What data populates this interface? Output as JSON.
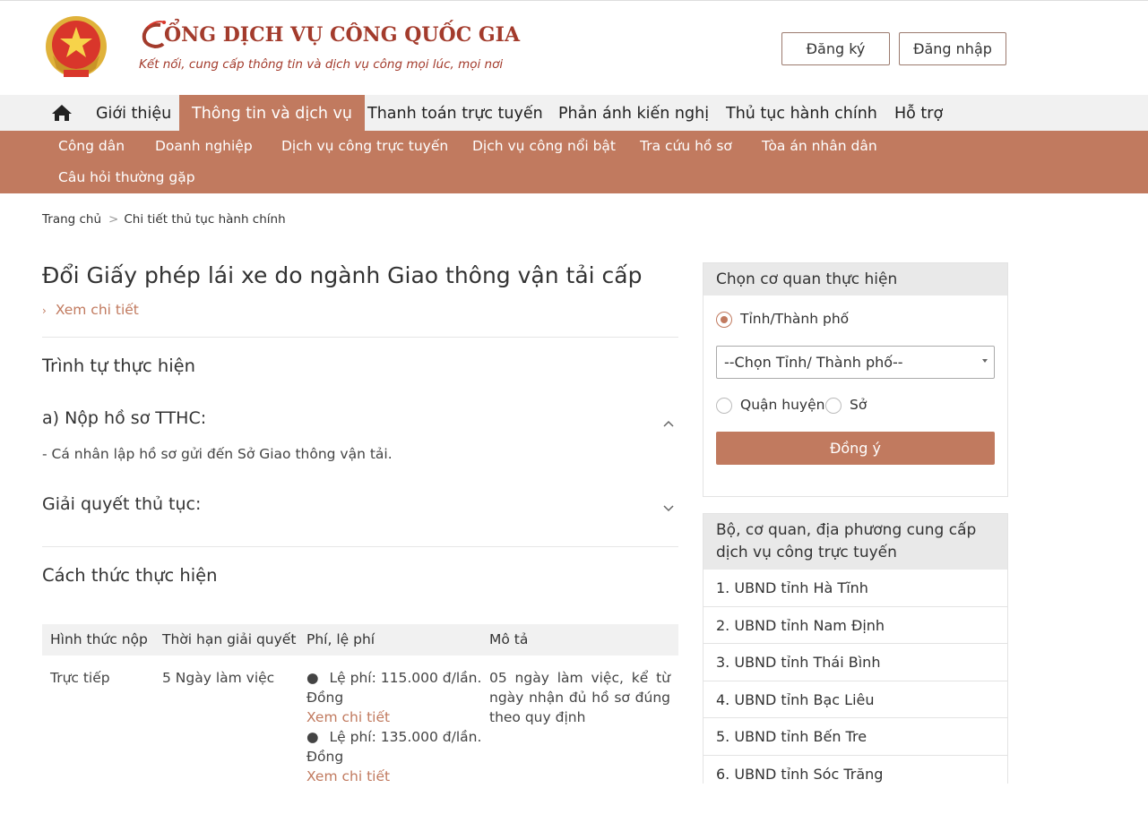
{
  "header": {
    "brand_title": "CỔNG DỊCH VỤ CÔNG QUỐC GIA",
    "brand_title_rest": "ỔNG DỊCH VỤ CÔNG QUỐC GIA",
    "brand_subtitle": "Kết nối, cung cấp thông tin và dịch vụ công mọi lúc, mọi nơi",
    "register_label": "Đăng ký",
    "login_label": "Đăng nhập"
  },
  "main_nav": {
    "items": [
      {
        "label": "Giới thiệu"
      },
      {
        "label": "Thông tin và dịch vụ",
        "active": true
      },
      {
        "label": "Thanh toán trực tuyến"
      },
      {
        "label": "Phản ánh kiến nghị"
      },
      {
        "label": "Thủ tục hành chính"
      },
      {
        "label": "Hỗ trợ"
      }
    ]
  },
  "sub_nav": {
    "items": [
      {
        "label": "Công dân"
      },
      {
        "label": "Doanh nghiệp"
      },
      {
        "label": "Dịch vụ công trực tuyến"
      },
      {
        "label": "Dịch vụ công nổi bật"
      },
      {
        "label": "Tra cứu hồ sơ"
      },
      {
        "label": "Tòa án nhân dân"
      },
      {
        "label": "Câu hỏi thường gặp"
      }
    ]
  },
  "breadcrumb": {
    "home": "Trang chủ",
    "separator": ">",
    "current": "Chi tiết thủ tục hành chính"
  },
  "content": {
    "title": "Đổi Giấy phép lái xe do ngành Giao thông vận tải cấp",
    "see_detail": "Xem chi tiết",
    "sequence_heading": "Trình tự thực hiện",
    "step_a_heading": "a) Nộp hồ sơ TTHC:",
    "step_a_text": "- Cá nhân lập hồ sơ gửi đến Sở Giao thông vận tải.",
    "resolve_heading": "Giải quyết thủ tục:",
    "method_heading": "Cách thức thực hiện",
    "table": {
      "headers": [
        "Hình thức nộp",
        "Thời hạn giải quyết",
        "Phí, lệ phí",
        "Mô tả"
      ],
      "rows": [
        {
          "method": "Trực tiếp",
          "deadline": "5 Ngày làm việc",
          "fees": [
            {
              "line1": "Lệ phí: 115.000 đ/lần.",
              "line2": "Đồng",
              "link": "Xem chi tiết"
            },
            {
              "line1": "Lệ phí: 135.000 đ/lần.",
              "line2": "Đồng",
              "link": "Xem chi tiết"
            }
          ],
          "description_lines": [
            "05 ngày làm việc, kể từ",
            "ngày nhận đủ hồ sơ đúng",
            "theo quy định"
          ]
        }
      ]
    }
  },
  "sidebar": {
    "agency_box": {
      "title": "Chọn cơ quan thực hiện",
      "option_province": "Tỉnh/Thành phố",
      "select_placeholder": "--Chọn Tỉnh/ Thành phố--",
      "option_district": "Quận huyện",
      "option_department": "Sở",
      "agree_label": "Đồng ý",
      "selected_option": "Tỉnh/Thành phố"
    },
    "providers_box": {
      "title_line1": "Bộ, cơ quan, địa phương cung cấp",
      "title_line2": "dịch vụ công trực tuyến",
      "items": [
        "1. UBND tỉnh Hà Tĩnh",
        "2. UBND tỉnh Nam Định",
        "3. UBND tỉnh Thái Bình",
        "4. UBND tỉnh Bạc Liêu",
        "5. UBND tỉnh Bến Tre",
        "6. UBND tỉnh Sóc Trăng"
      ]
    }
  },
  "colors": {
    "accent": "#c17a5f",
    "brand_red": "#a33b2c",
    "nav_bg": "#f1f1f1"
  },
  "icons": {
    "home": "home-icon",
    "emblem": "national-emblem-icon",
    "chevron_up": "chevron-up-icon",
    "chevron_down": "chevron-down-icon"
  }
}
